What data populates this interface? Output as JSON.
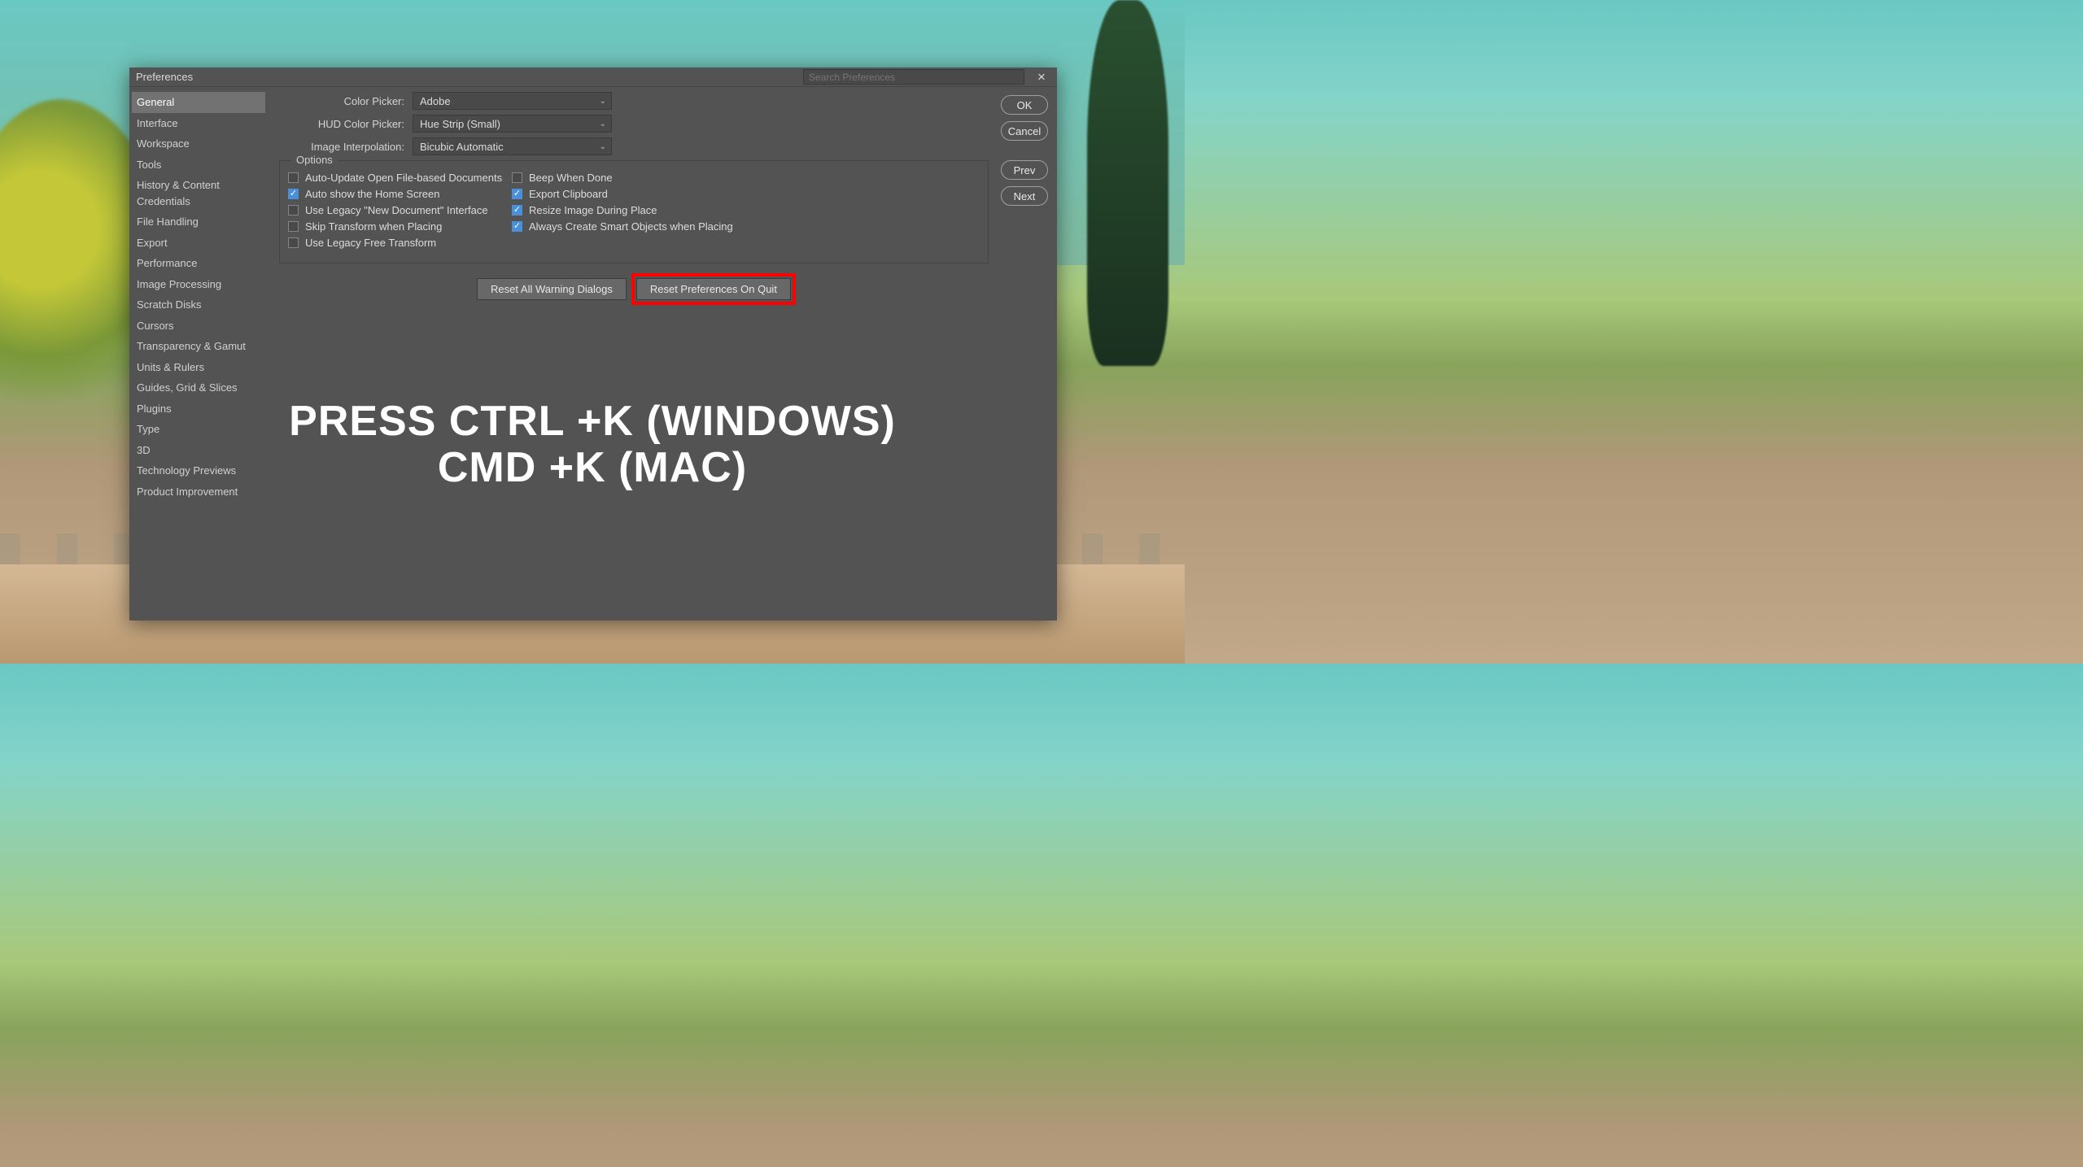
{
  "titlebar": {
    "title": "Preferences",
    "search_placeholder": "Search Preferences"
  },
  "sidebar": {
    "items": [
      "General",
      "Interface",
      "Workspace",
      "Tools",
      "History & Content Credentials",
      "File Handling",
      "Export",
      "Performance",
      "Image Processing",
      "Scratch Disks",
      "Cursors",
      "Transparency & Gamut",
      "Units & Rulers",
      "Guides, Grid & Slices",
      "Plugins",
      "Type",
      "3D",
      "Technology Previews",
      "Product Improvement"
    ],
    "active_index": 0
  },
  "form": {
    "color_picker_label": "Color Picker:",
    "color_picker_value": "Adobe",
    "hud_label": "HUD Color Picker:",
    "hud_value": "Hue Strip (Small)",
    "interp_label": "Image Interpolation:",
    "interp_value": "Bicubic Automatic"
  },
  "options": {
    "legend": "Options",
    "left": [
      {
        "label": "Auto-Update Open File-based Documents",
        "checked": false
      },
      {
        "label": "Auto show the Home Screen",
        "checked": true
      },
      {
        "label": "Use Legacy \"New Document\" Interface",
        "checked": false
      },
      {
        "label": "Skip Transform when Placing",
        "checked": false
      },
      {
        "label": "Use Legacy Free Transform",
        "checked": false
      }
    ],
    "right": [
      {
        "label": "Beep When Done",
        "checked": false
      },
      {
        "label": "Export Clipboard",
        "checked": true
      },
      {
        "label": "Resize Image During Place",
        "checked": true
      },
      {
        "label": "Always Create Smart Objects when Placing",
        "checked": true
      }
    ]
  },
  "buttons": {
    "reset_warnings": "Reset All Warning Dialogs",
    "reset_prefs": "Reset Preferences On Quit",
    "ok": "OK",
    "cancel": "Cancel",
    "prev": "Prev",
    "next": "Next"
  },
  "overlay": {
    "line1": "PRESS CTRL +K (WINDOWS)",
    "line2": "CMD +K (MAC)"
  }
}
